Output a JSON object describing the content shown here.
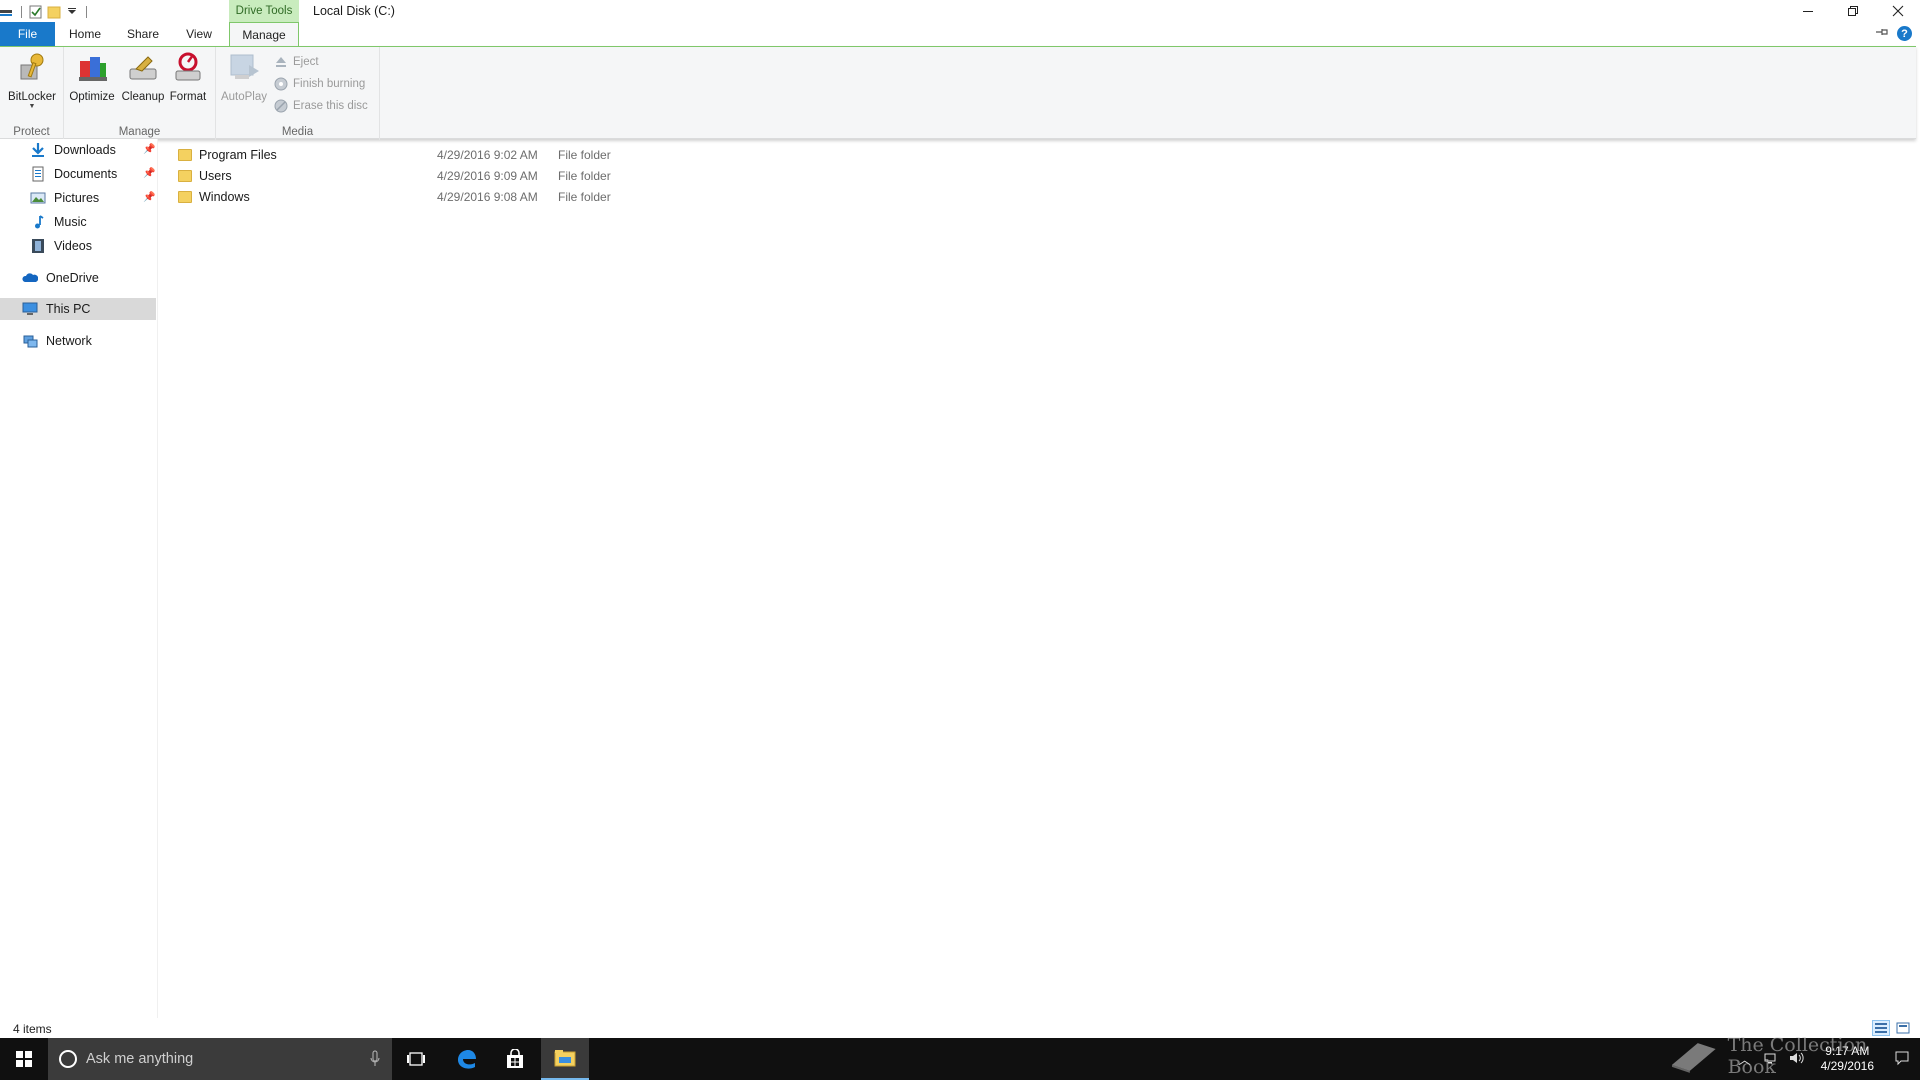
{
  "titlebar": {
    "context_tab": "Drive Tools",
    "window_title": "Local Disk (C:)"
  },
  "ribbon_tabs": {
    "file": "File",
    "home": "Home",
    "share": "Share",
    "view": "View",
    "manage": "Manage"
  },
  "ribbon": {
    "groups": {
      "protect": "Protect",
      "manage": "Manage",
      "media": "Media"
    },
    "buttons": {
      "bitlocker": "BitLocker",
      "optimize": "Optimize",
      "cleanup": "Cleanup",
      "format": "Format",
      "autoplay": "AutoPlay",
      "eject": "Eject",
      "finish_burning": "Finish burning",
      "erase_disc": "Erase this disc"
    }
  },
  "nav": {
    "items": [
      {
        "label": "Downloads",
        "icon": "download-arrow-icon",
        "pinned": true
      },
      {
        "label": "Documents",
        "icon": "document-icon",
        "pinned": true
      },
      {
        "label": "Pictures",
        "icon": "pictures-icon",
        "pinned": true
      },
      {
        "label": "Music",
        "icon": "music-note-icon",
        "pinned": false
      },
      {
        "label": "Videos",
        "icon": "film-icon",
        "pinned": false
      },
      {
        "label": "OneDrive",
        "icon": "cloud-icon",
        "pinned": false
      },
      {
        "label": "This PC",
        "icon": "monitor-icon",
        "pinned": false,
        "selected": true
      },
      {
        "label": "Network",
        "icon": "network-icon",
        "pinned": false
      }
    ]
  },
  "files": [
    {
      "name": "Program Files",
      "date": "4/29/2016 9:02 AM",
      "type": "File folder"
    },
    {
      "name": "Users",
      "date": "4/29/2016 9:09 AM",
      "type": "File folder"
    },
    {
      "name": "Windows",
      "date": "4/29/2016 9:08 AM",
      "type": "File folder"
    }
  ],
  "status": {
    "item_count": "4 items"
  },
  "taskbar": {
    "search_placeholder": "Ask me anything",
    "time": "9:17 AM",
    "date": "4/29/2016"
  },
  "watermark": {
    "text": "The Collection Book"
  },
  "colors": {
    "file_tab": "#1979ca",
    "context_tab_bg": "#c9ecbe",
    "context_tab_text": "#2f6a25",
    "ribbon_bg": "#f5f6f7",
    "selected_nav": "#d9d9d9",
    "taskbar": "#101010",
    "folder": "#f4d160"
  }
}
